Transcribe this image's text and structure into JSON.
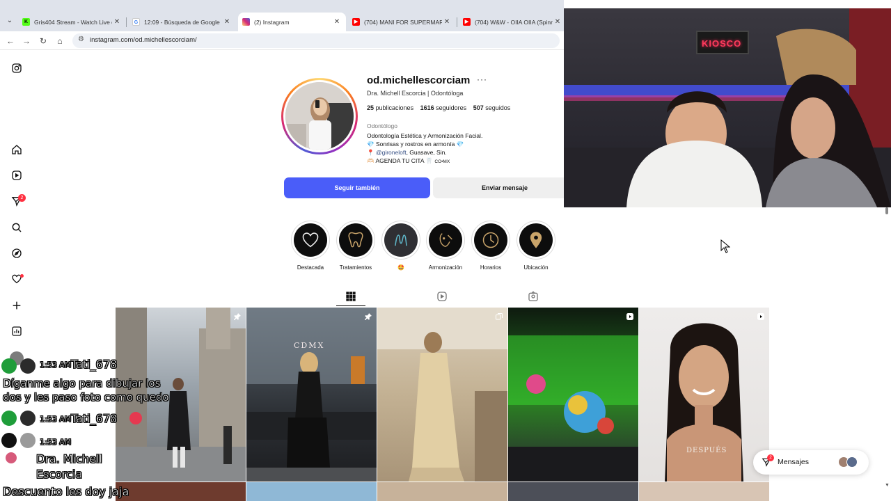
{
  "browser": {
    "tabs": [
      {
        "title": "Gris404 Stream - Watch Live on",
        "favicon": "kick-icon",
        "color": "#53fc18"
      },
      {
        "title": "12:09 - Búsqueda de Google",
        "favicon": "google-icon",
        "color": "#4285f4"
      },
      {
        "title": "(2) Instagram",
        "favicon": "instagram-icon",
        "color": "#d62976"
      },
      {
        "title": "(704) MANI FOR SUPERMARKE",
        "favicon": "youtube-icon",
        "color": "#ff0000"
      },
      {
        "title": "(704) W&W - OIIA OIIA (Spinn",
        "favicon": "youtube-icon",
        "color": "#ff0000"
      }
    ],
    "url": "instagram.com/od.michellescorciam/"
  },
  "sidebar": {
    "notifications_badge": "2"
  },
  "profile": {
    "username": "od.michellescorciam",
    "more_label": "···",
    "full_name_line": "Dra. Michell Escorcia | Odontóloga",
    "posts_count": "25",
    "posts_label": "publicaciones",
    "followers_count": "1616",
    "followers_label": "seguidores",
    "following_count": "507",
    "following_label": "seguidos",
    "category": "Odontólogo",
    "bio": {
      "line1": "Odontología Estética y Armonización Facial.",
      "line2": "💎 Sonrisas y rostros en armonía 💎",
      "line3_pin": "📍",
      "line3_link": "@gironeloft",
      "line3_rest": ", Guasave, Sin.",
      "line4": "🫶🏻 AGENDA TU CITA 🦷",
      "line4_small": "CO•MX"
    },
    "follow_button": "Seguir también",
    "message_button": "Enviar mensaje"
  },
  "highlights": [
    {
      "label": "Destacada",
      "icon": "heart-icon"
    },
    {
      "label": "Tratamientos",
      "icon": "tooth-icon"
    },
    {
      "label": "🤩",
      "icon": "letter-m-icon"
    },
    {
      "label": "Armonización",
      "icon": "face-icon"
    },
    {
      "label": "Horarios",
      "icon": "clock-icon"
    },
    {
      "label": "Ubicación",
      "icon": "location-pin-icon"
    }
  ],
  "posts": [
    {
      "caption": "",
      "kind": "pinned"
    },
    {
      "caption": "CDMX",
      "kind": "pinned"
    },
    {
      "caption": "",
      "kind": "carousel"
    },
    {
      "caption": "",
      "kind": "reel"
    },
    {
      "caption": "DESPUÉS",
      "kind": "reel"
    }
  ],
  "messages_pill": {
    "label": "Mensajes",
    "badge": "2"
  },
  "webcam": {
    "neon_sign": "KIOSCO"
  },
  "stream_chat": {
    "msg1_time": "1:53 AM",
    "msg1_user": "Tati_678",
    "msg1_text_a": "Díganme algo para dibujar los",
    "msg1_text_b": "dos y les paso foto como quedo",
    "msg2_time": "1:53 AM",
    "msg2_user": "Tati_678",
    "msg3_time": "1:53 AM",
    "msg3_user_a": "Dra. Michell",
    "msg3_user_b": "Escorcia",
    "msg3_text": "Descuento les doy jaja"
  }
}
